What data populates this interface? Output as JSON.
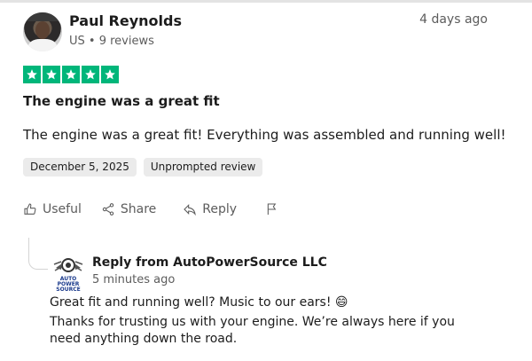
{
  "review": {
    "author": "Paul Reynolds",
    "meta": "US • 9 reviews",
    "posted_ago": "4 days ago",
    "rating": 5,
    "title": "The engine was a great fit",
    "body": "The engine was a great fit! Everything was assembled and running well!",
    "tags": [
      "December 5, 2025",
      "Unprompted review"
    ],
    "actions": {
      "useful": "Useful",
      "share": "Share",
      "reply": "Reply"
    }
  },
  "reply": {
    "logo_text": "AUTO POWER SOURCE",
    "from": "Reply from AutoPowerSource LLC",
    "time": "5 minutes ago",
    "line1": "Great fit and running well? Music to our ears! 😄",
    "line2": "Thanks for trusting us with your engine. We’re always here if you need anything down the road."
  },
  "colors": {
    "star": "#00b67a",
    "tag_bg": "#ebebeb",
    "muted": "#5c5c5c"
  }
}
